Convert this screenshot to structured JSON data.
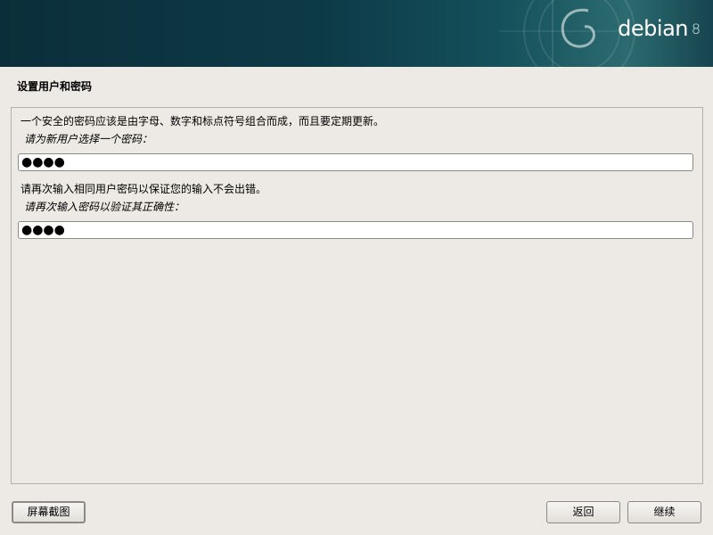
{
  "banner": {
    "brand": "debian",
    "version": "8"
  },
  "page": {
    "title": "设置用户和密码"
  },
  "form": {
    "intro": "一个安全的密码应该是由字母、数字和标点符号组合而成，而且要定期更新。",
    "password_prompt": "请为新用户选择一个密码：",
    "password_value": "●●●●",
    "verify_info": "请再次输入相同用户密码以保证您的输入不会出错。",
    "verify_prompt": "请再次输入密码以验证其正确性：",
    "verify_value": "●●●●"
  },
  "buttons": {
    "screenshot": "屏幕截图",
    "back": "返回",
    "continue": "继续"
  }
}
